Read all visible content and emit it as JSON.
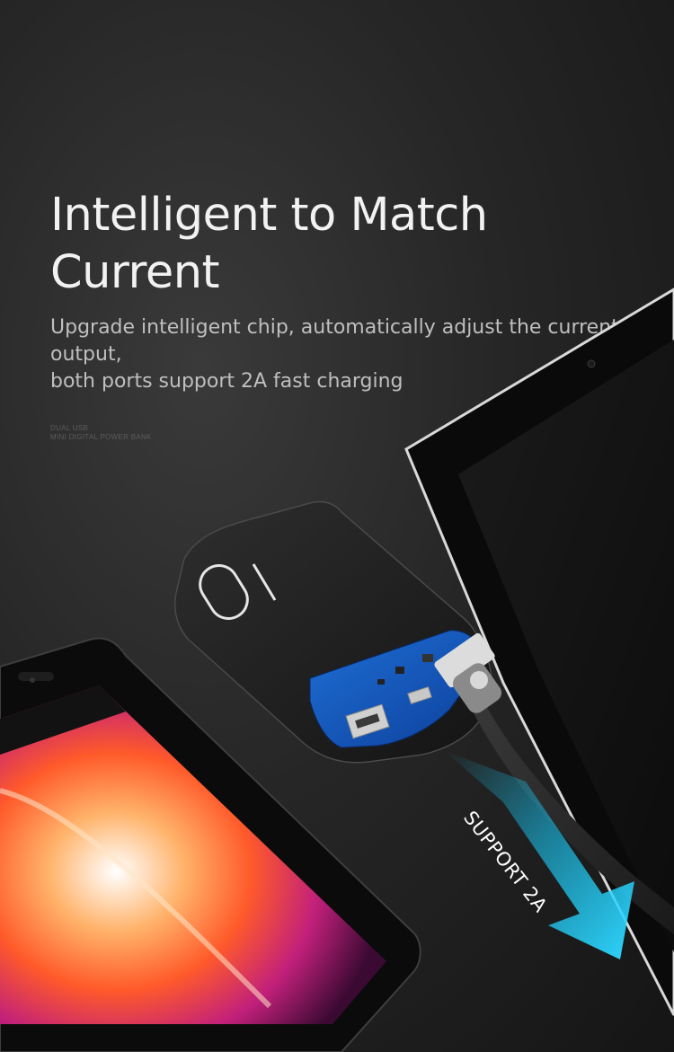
{
  "headline": "Intelligent to Match Current",
  "subtitle_line1": "Upgrade intelligent chip, automatically adjust the current output,",
  "subtitle_line2": "both ports support 2A fast charging",
  "micro_line1": "DUAL USB",
  "micro_line2": "MINI DIGITAL POWER BANK",
  "power_bank_capacity_mark": "10",
  "arrow_label": "SUPPORT 2A",
  "colors": {
    "background": "#262626",
    "headline": "#f2f2f2",
    "subtitle": "#bfbfbf",
    "arrow_accent": "#19c6f2"
  }
}
